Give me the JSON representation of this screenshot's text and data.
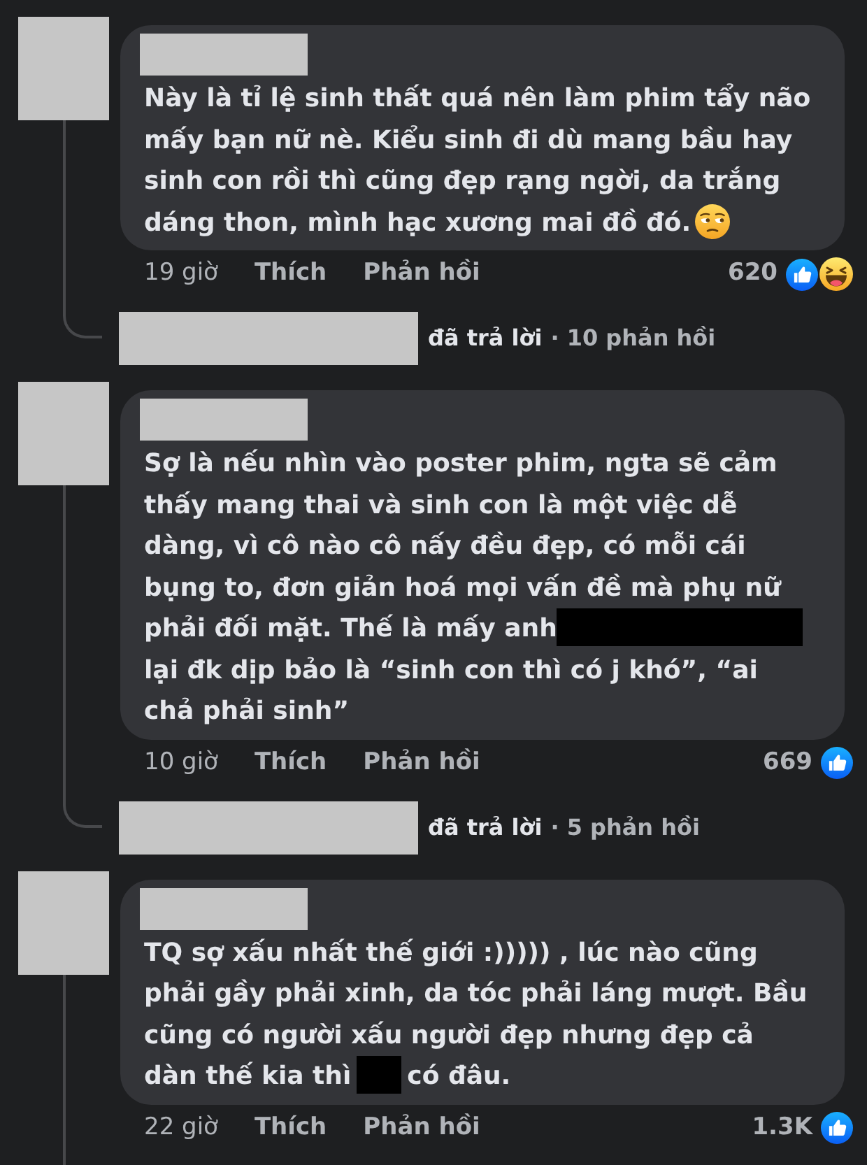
{
  "comments": [
    {
      "name_hidden": true,
      "body": [
        [
          {
            "kind": "text",
            "text": "Này là tỉ lệ sinh thất quá nên làm phim tẩy não mấy bạn nữ nè. Kiểu sinh đi dù mang bầu hay sinh con rồi thì cũng đẹp rạng ngời, da trắng"
          }
        ],
        [
          {
            "kind": "text",
            "text": "dáng thon, mình hạc xương mai đồ đó."
          },
          {
            "kind": "emoji"
          }
        ]
      ],
      "time": "19 giờ",
      "like_label": "Thích",
      "reply_label": "Phản hồi",
      "reaction_count": "620",
      "reactions": [
        {
          "kind": "like"
        },
        {
          "kind": "haha"
        }
      ],
      "replies": {
        "replier_hidden": true,
        "action": "đã trả lời",
        "count": "· 10 phản hồi"
      }
    },
    {
      "name_hidden": true,
      "body": [
        [
          {
            "kind": "text",
            "text": "Sợ là nếu nhìn vào poster phim, ngta sẽ cảm thấy mang thai và sinh con là một việc dễ dàng, vì cô nào cô nấy đều đẹp, có mỗi cái bụng to, đơn giản hoá mọi vấn đề mà phụ nữ phải đối mặt. Thế là mấy anh"
          },
          {
            "kind": "censored",
            "wide": true
          }
        ],
        [
          {
            "kind": "text",
            "text": "lại đk dịp bảo là “sinh con thì có j khó”, “ai chả phải sinh”"
          }
        ]
      ],
      "time": "10 giờ",
      "like_label": "Thích",
      "reply_label": "Phản hồi",
      "reaction_count": "669",
      "reactions": [
        {
          "kind": "like"
        }
      ],
      "replies": {
        "replier_hidden": true,
        "action": "đã trả lời",
        "count": "· 5 phản hồi"
      }
    },
    {
      "name_hidden": true,
      "body": [
        [
          {
            "kind": "text",
            "text": "TQ sợ xấu nhất thế giới :))))) , lúc nào cũng phải gầy phải xinh, da tóc phải láng mượt. Bầu cũng có người xấu người đẹp nhưng đẹp cả"
          }
        ],
        [
          {
            "kind": "text",
            "text": "dàn thế kia thì"
          },
          {
            "kind": "censored",
            "wide": false
          },
          {
            "kind": "text",
            "text": "có đâu."
          }
        ]
      ],
      "time": "22 giờ",
      "like_label": "Thích",
      "reply_label": "Phản hồi",
      "reaction_count": "1.3K",
      "reactions": [
        {
          "kind": "like"
        }
      ]
    }
  ]
}
